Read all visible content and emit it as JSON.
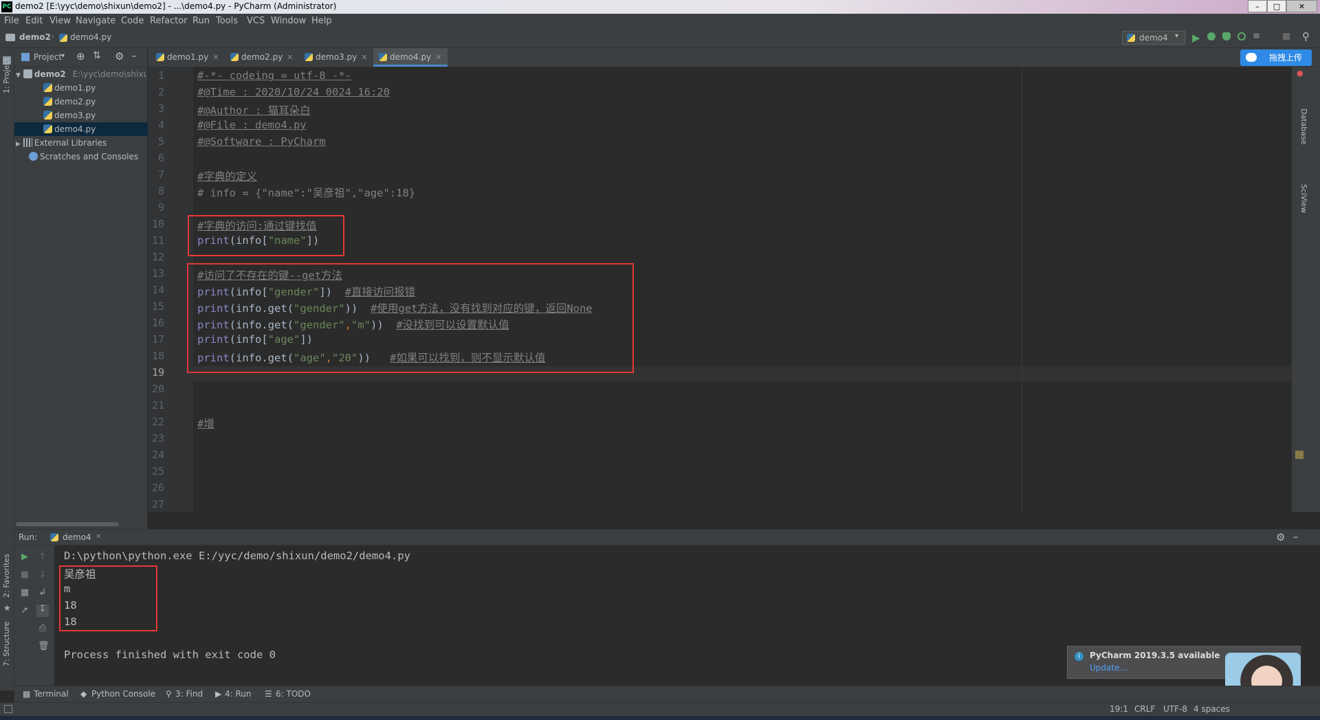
{
  "window": {
    "title": "demo2 [E:\\yyc\\demo\\shixun\\demo2] - ...\\demo4.py - PyCharm (Administrator)",
    "logo_text": "PC"
  },
  "menu": [
    "File",
    "Edit",
    "View",
    "Navigate",
    "Code",
    "Refactor",
    "Run",
    "Tools",
    "VCS",
    "Window",
    "Help"
  ],
  "breadcrumb": {
    "project": "demo2",
    "file": "demo4.py"
  },
  "run_config": "demo4",
  "upload_button": "拖拽上传",
  "left_strip": {
    "project": "1: Project",
    "favorites": "2: Favorites",
    "structure": "7: Structure"
  },
  "right_strip": {
    "database": "Database",
    "sciview": "SciView"
  },
  "project_panel": {
    "title": "Project",
    "root_name": "demo2",
    "root_path": "E:\\yyc\\demo\\shixun",
    "files": [
      "demo1.py",
      "demo2.py",
      "demo3.py",
      "demo4.py"
    ],
    "selected_file": "demo4.py",
    "external": "External Libraries",
    "scratches": "Scratches and Consoles"
  },
  "tabs": [
    "demo1.py",
    "demo2.py",
    "demo3.py",
    "demo4.py"
  ],
  "active_tab": "demo4.py",
  "line_numbers": [
    "1",
    "2",
    "3",
    "4",
    "5",
    "6",
    "7",
    "8",
    "9",
    "10",
    "11",
    "12",
    "13",
    "14",
    "15",
    "16",
    "17",
    "18",
    "19",
    "20",
    "21",
    "22",
    "23",
    "24",
    "25",
    "26",
    "27"
  ],
  "code": {
    "l1": "#-*- codeing = utf-8 -*-",
    "l2": "#@Time : 2020/10/24 0024 16:20",
    "l3": "#@Author : 猫耳朵白",
    "l4": "#@File : demo4.py",
    "l5": "#@Software : PyCharm",
    "l7": "#字典的定义",
    "l8": "# info = {\"name\":\"吴彦祖\",\"age\":18}",
    "l10": "#字典的访问:通过键找值",
    "l11_a": "print",
    "l11_b": "(info[",
    "l11_c": "\"name\"",
    "l11_d": "])",
    "l13": "#访问了不存在的键--get方法",
    "l14_a": "print",
    "l14_b": "(info[",
    "l14_c": "\"gender\"",
    "l14_d": "])  ",
    "l14_e": "#直接访问报错",
    "l15_a": "print",
    "l15_b": "(info.get(",
    "l15_c": "\"gender\"",
    "l15_d": "))  ",
    "l15_e": "#使用get方法，没有找到对应的键，返回None",
    "l16_a": "print",
    "l16_b": "(info.get(",
    "l16_c": "\"gender\"",
    "l16_d": ",",
    "l16_e": "\"m\"",
    "l16_f": "))  ",
    "l16_g": "#没找到可以设置默认值",
    "l17_a": "print",
    "l17_b": "(info[",
    "l17_c": "\"age\"",
    "l17_d": "])",
    "l18_a": "print",
    "l18_b": "(info.get(",
    "l18_c": "\"age\"",
    "l18_d": ",",
    "l18_e": "\"20\"",
    "l18_f": "))   ",
    "l18_g": "#如果可以找到，则不显示默认值",
    "l22": "#增"
  },
  "run": {
    "label": "Run:",
    "tab": "demo4",
    "command": "D:\\python\\python.exe E:/yyc/demo/shixun/demo2/demo4.py",
    "output": [
      "吴彦祖",
      "m",
      "18",
      "18"
    ],
    "finished": "Process finished with exit code 0"
  },
  "toolwindows": [
    "Terminal",
    "Python Console",
    "3: Find",
    "4: Run",
    "6: TODO"
  ],
  "status": {
    "position": "19:1",
    "line_sep": "CRLF",
    "encoding": "UTF-8",
    "indent": "4 spaces"
  },
  "notification": {
    "title": "PyCharm 2019.3.5 available",
    "link": "Update..."
  },
  "colors": {
    "accent": "#4a88c7",
    "highlight_box": "#e53935",
    "run_green": "#59a869"
  }
}
